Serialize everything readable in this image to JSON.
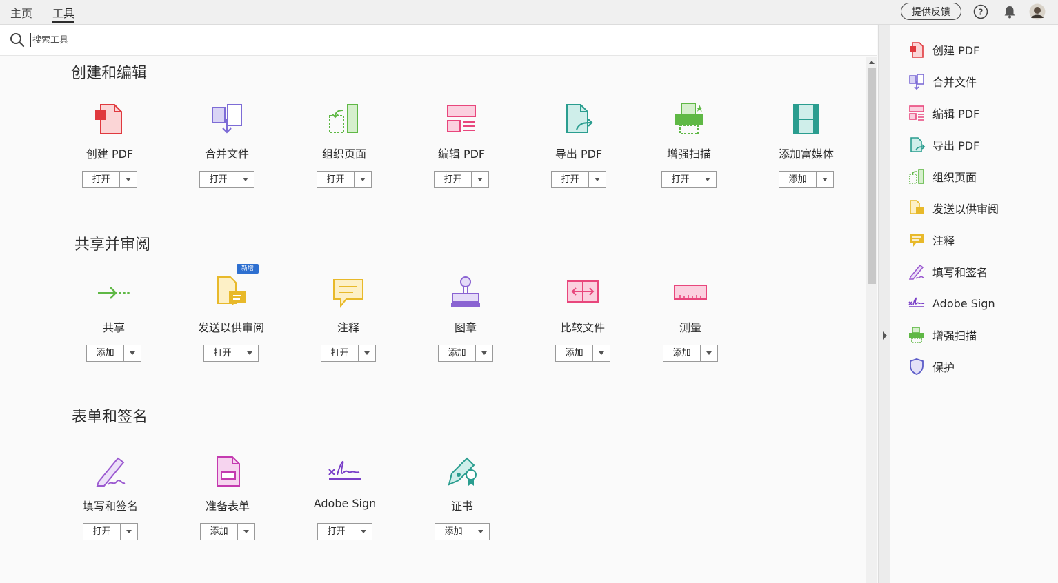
{
  "nav": {
    "home": "主页",
    "tools": "工具"
  },
  "header": {
    "feedback": "提供反馈"
  },
  "search": {
    "placeholder": "搜索工具"
  },
  "sections": [
    {
      "title": "创建和编辑",
      "tools": [
        {
          "name": "创建 PDF",
          "action": "打开"
        },
        {
          "name": "合并文件",
          "action": "打开"
        },
        {
          "name": "组织页面",
          "action": "打开"
        },
        {
          "name": "编辑 PDF",
          "action": "打开"
        },
        {
          "name": "导出 PDF",
          "action": "打开"
        },
        {
          "name": "增强扫描",
          "action": "打开"
        },
        {
          "name": "添加富媒体",
          "action": "添加"
        }
      ]
    },
    {
      "title": "共享并审阅",
      "badge": "新增",
      "tools": [
        {
          "name": "共享",
          "action": "添加"
        },
        {
          "name": "发送以供审阅",
          "action": "打开"
        },
        {
          "name": "注释",
          "action": "打开"
        },
        {
          "name": "图章",
          "action": "添加"
        },
        {
          "name": "比较文件",
          "action": "添加"
        },
        {
          "name": "测量",
          "action": "添加"
        }
      ]
    },
    {
      "title": "表单和签名",
      "tools": [
        {
          "name": "填写和签名",
          "action": "打开"
        },
        {
          "name": "准备表单",
          "action": "添加"
        },
        {
          "name": "Adobe Sign",
          "action": "打开"
        },
        {
          "name": "证书",
          "action": "添加"
        }
      ]
    }
  ],
  "right_panel": [
    {
      "label": "创建 PDF",
      "icon": "create-pdf-icon"
    },
    {
      "label": "合并文件",
      "icon": "combine-files-icon"
    },
    {
      "label": "编辑 PDF",
      "icon": "edit-pdf-icon"
    },
    {
      "label": "导出 PDF",
      "icon": "export-pdf-icon"
    },
    {
      "label": "组织页面",
      "icon": "organize-pages-icon"
    },
    {
      "label": "发送以供审阅",
      "icon": "send-review-icon"
    },
    {
      "label": "注释",
      "icon": "comment-icon"
    },
    {
      "label": "填写和签名",
      "icon": "fill-sign-icon"
    },
    {
      "label": "Adobe Sign",
      "icon": "adobe-sign-icon"
    },
    {
      "label": "增强扫描",
      "icon": "scan-icon"
    },
    {
      "label": "保护",
      "icon": "protect-icon"
    }
  ],
  "colors": {
    "accent_blue": "#2d6fd0",
    "red": "#e0393e",
    "purple": "#7d6cd6",
    "green": "#5fb845",
    "pink": "#e8467c",
    "teal": "#2a9d8f",
    "yellow": "#e8b92a",
    "violet": "#9b59d0"
  }
}
